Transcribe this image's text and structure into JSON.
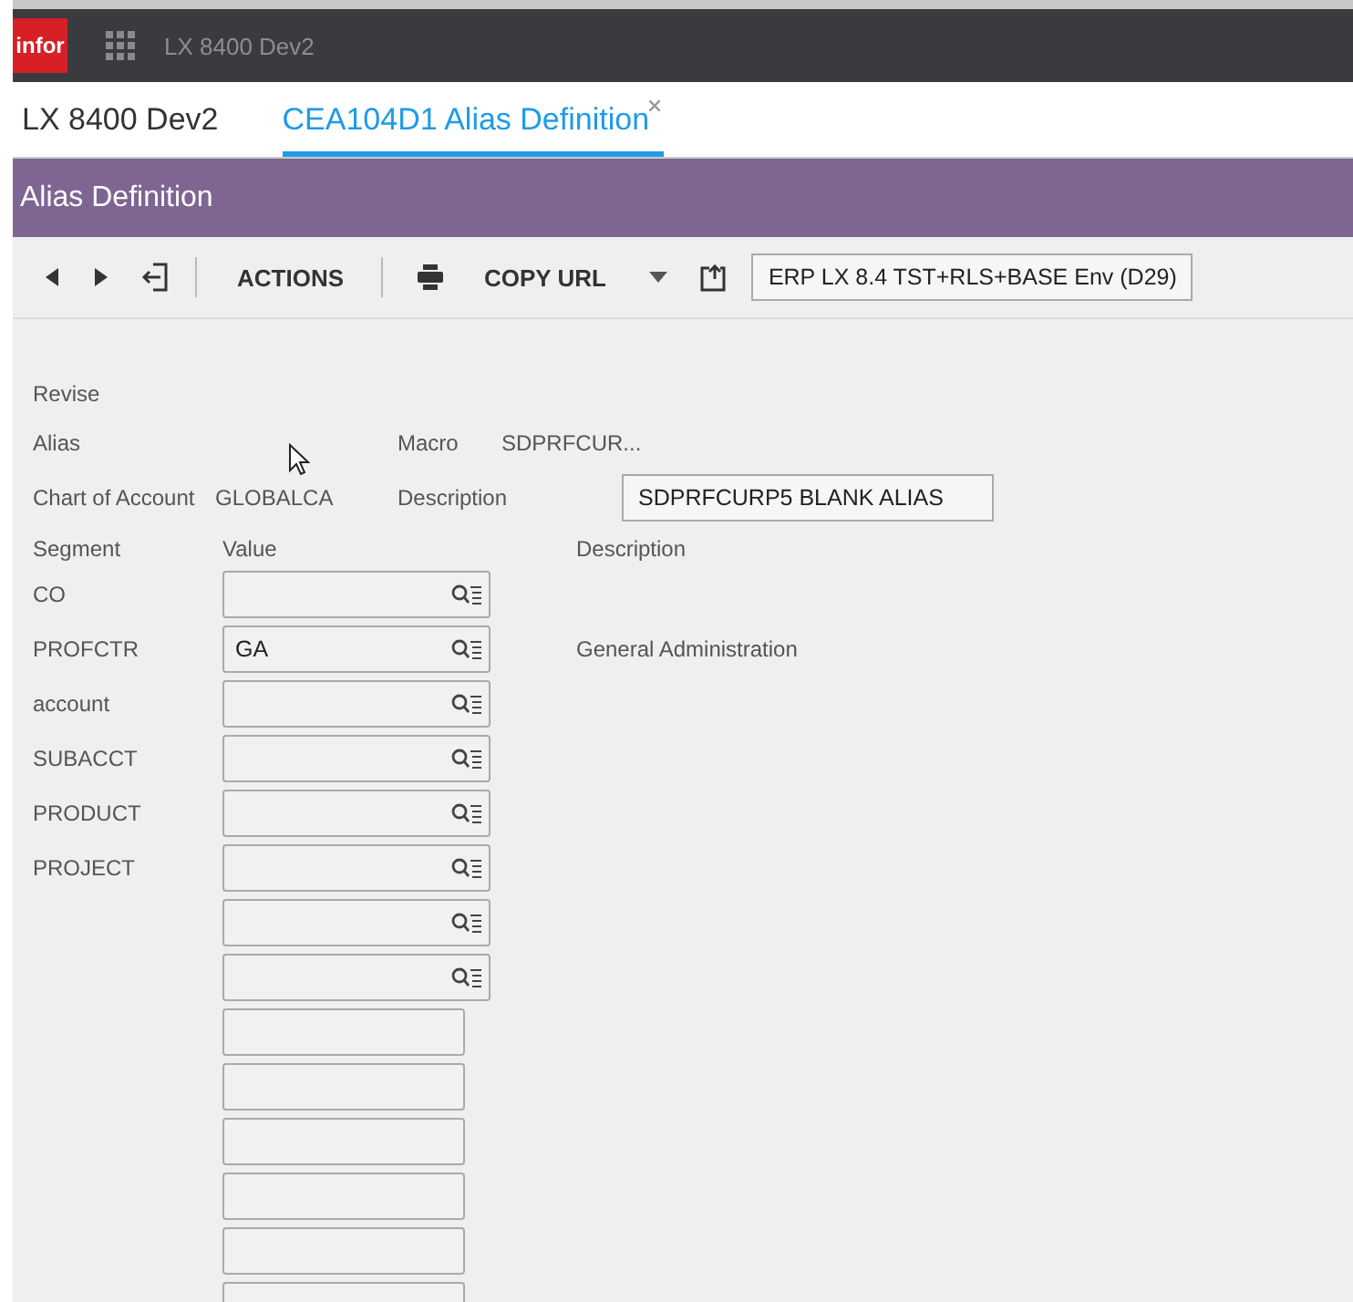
{
  "app_bar": {
    "logo": "infor",
    "title": "LX 8400 Dev2"
  },
  "tabs": [
    {
      "label": "LX 8400 Dev2",
      "selected": false,
      "closable": false
    },
    {
      "label": "CEA104D1 Alias Definition",
      "selected": true,
      "closable": true
    }
  ],
  "header": {
    "title": "Alias Definition"
  },
  "toolbar": {
    "actions": "ACTIONS",
    "copy_url": "COPY URL",
    "environment": "ERP LX 8.4 TST+RLS+BASE Env (D29)"
  },
  "form": {
    "mode": "Revise",
    "alias_label": "Alias",
    "macro_label": "Macro",
    "macro": "SDPRFCUR...",
    "chart_label": "Chart of Account",
    "chart": "GLOBALCA",
    "description_label": "Description",
    "description": "SDPRFCURP5 BLANK ALIAS"
  },
  "segments": {
    "columns": [
      "Segment",
      "Value",
      "Description"
    ],
    "rows": [
      {
        "kind": "lookup",
        "segment": "CO"
      },
      {
        "kind": "lookup",
        "segment": "PROFCTR",
        "value": "GA",
        "description": "General Administration"
      },
      {
        "kind": "lookup",
        "segment": "account"
      },
      {
        "kind": "lookup",
        "segment": "SUBACCT"
      },
      {
        "kind": "lookup",
        "segment": "PRODUCT"
      },
      {
        "kind": "lookup",
        "segment": "PROJECT"
      },
      {
        "kind": "lookup"
      },
      {
        "kind": "lookup"
      },
      {
        "kind": "plain"
      },
      {
        "kind": "plain"
      },
      {
        "kind": "plain"
      },
      {
        "kind": "plain"
      },
      {
        "kind": "plain"
      },
      {
        "kind": "plain"
      }
    ]
  }
}
